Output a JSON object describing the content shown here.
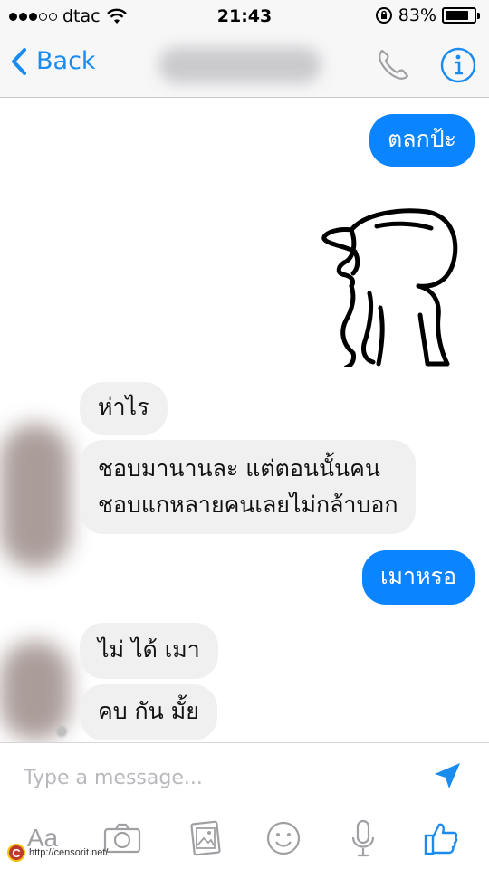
{
  "status_bar": {
    "carrier": "dtac",
    "time": "21:43",
    "battery_text": "83%",
    "battery_level": 0.83,
    "signal_bars_filled": 3,
    "signal_bars_total": 5
  },
  "nav": {
    "back_label": "Back",
    "accent_color": "#1a8cf0",
    "call_icon": "phone-icon",
    "info_icon": "info-icon"
  },
  "messages": [
    {
      "side": "out",
      "text": "ตลกป้ะ"
    },
    {
      "side": "in",
      "type": "sticker",
      "icon": "cartoon-character-sticker"
    },
    {
      "side": "in",
      "text": "ห่าไร"
    },
    {
      "side": "in",
      "lines": [
        "ชอบมานานละ แต่ตอนนั้นคน",
        "ชอบแกหลายคนเลยไม่กล้าบอก"
      ]
    },
    {
      "side": "out",
      "text": "เมาหรอ"
    },
    {
      "side": "in",
      "text": "ไม่ ได้ เมา"
    },
    {
      "side": "in",
      "text": "คบ กัน มั้ย"
    }
  ],
  "composer": {
    "placeholder": "Type a message...",
    "send_icon": "send-arrow-icon",
    "toolbar": {
      "text_label": "Aa",
      "icons": [
        "camera-icon",
        "photo-gallery-icon",
        "emoji-icon",
        "microphone-icon",
        "thumbs-up-icon"
      ]
    }
  },
  "watermark": {
    "logo_letter": "C",
    "text": "http://censorit.net/"
  },
  "colors": {
    "outgoing_bubble": "#0a84ff",
    "incoming_bubble": "#f0f0f1",
    "icon_gray": "#a0a0a4"
  }
}
